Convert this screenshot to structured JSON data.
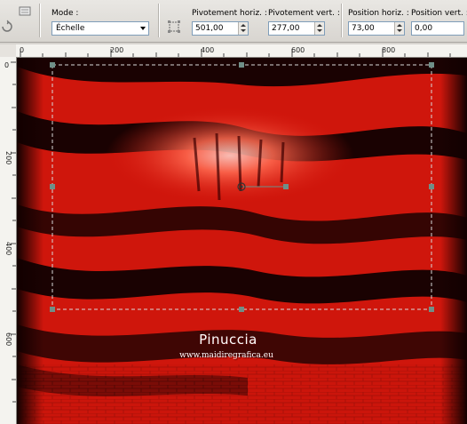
{
  "toolbar": {
    "mode_label": "Mode :",
    "mode_value": "Échelle",
    "pivot_h_label": "Pivotement horiz. :",
    "pivot_h_value": "501,00",
    "pivot_v_label": "Pivotement vert. :",
    "pivot_v_value": "277,00",
    "pos_h_label": "Position horiz. :",
    "pos_h_value": "73,00",
    "pos_v_label": "Position vert. :",
    "pos_v_value": "0,00"
  },
  "ruler": {
    "top_labels": [
      "0",
      "200",
      "400",
      "600",
      "800"
    ],
    "left_labels": [
      "0",
      "200",
      "400",
      "600"
    ]
  },
  "watermark": {
    "name": "Pinuccia",
    "url": "www.maidiregrafica.eu"
  },
  "colors": {
    "accent_red": "#d4150b",
    "dark": "#120000",
    "selection": "#6f8f88"
  }
}
